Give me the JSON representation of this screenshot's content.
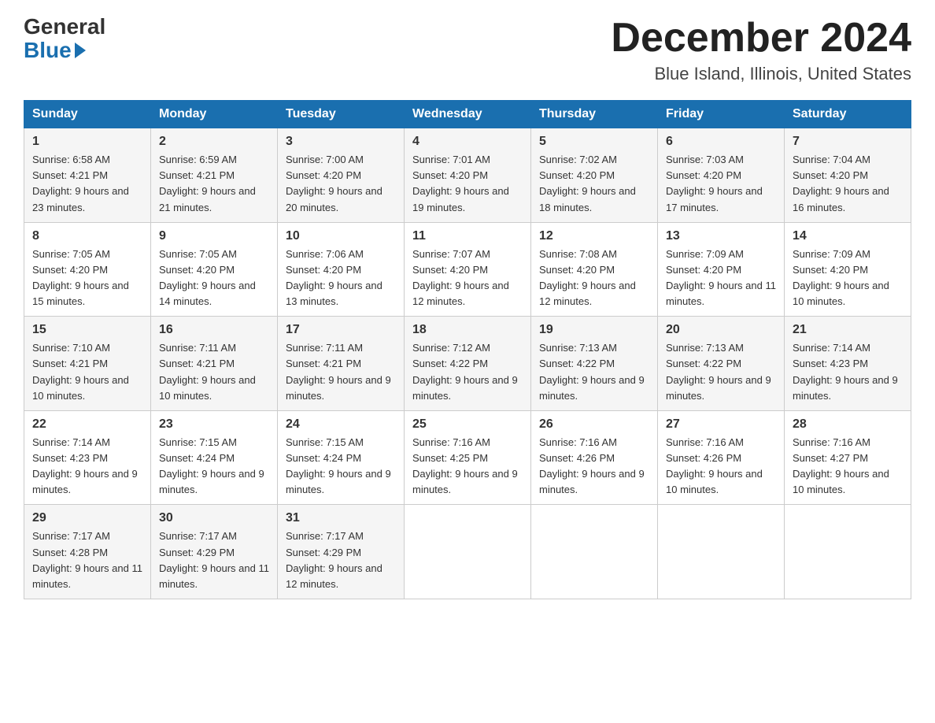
{
  "logo": {
    "general": "General",
    "blue": "Blue"
  },
  "header": {
    "month": "December 2024",
    "location": "Blue Island, Illinois, United States"
  },
  "days_of_week": [
    "Sunday",
    "Monday",
    "Tuesday",
    "Wednesday",
    "Thursday",
    "Friday",
    "Saturday"
  ],
  "weeks": [
    [
      {
        "day": "1",
        "sunrise": "6:58 AM",
        "sunset": "4:21 PM",
        "daylight": "9 hours and 23 minutes."
      },
      {
        "day": "2",
        "sunrise": "6:59 AM",
        "sunset": "4:21 PM",
        "daylight": "9 hours and 21 minutes."
      },
      {
        "day": "3",
        "sunrise": "7:00 AM",
        "sunset": "4:20 PM",
        "daylight": "9 hours and 20 minutes."
      },
      {
        "day": "4",
        "sunrise": "7:01 AM",
        "sunset": "4:20 PM",
        "daylight": "9 hours and 19 minutes."
      },
      {
        "day": "5",
        "sunrise": "7:02 AM",
        "sunset": "4:20 PM",
        "daylight": "9 hours and 18 minutes."
      },
      {
        "day": "6",
        "sunrise": "7:03 AM",
        "sunset": "4:20 PM",
        "daylight": "9 hours and 17 minutes."
      },
      {
        "day": "7",
        "sunrise": "7:04 AM",
        "sunset": "4:20 PM",
        "daylight": "9 hours and 16 minutes."
      }
    ],
    [
      {
        "day": "8",
        "sunrise": "7:05 AM",
        "sunset": "4:20 PM",
        "daylight": "9 hours and 15 minutes."
      },
      {
        "day": "9",
        "sunrise": "7:05 AM",
        "sunset": "4:20 PM",
        "daylight": "9 hours and 14 minutes."
      },
      {
        "day": "10",
        "sunrise": "7:06 AM",
        "sunset": "4:20 PM",
        "daylight": "9 hours and 13 minutes."
      },
      {
        "day": "11",
        "sunrise": "7:07 AM",
        "sunset": "4:20 PM",
        "daylight": "9 hours and 12 minutes."
      },
      {
        "day": "12",
        "sunrise": "7:08 AM",
        "sunset": "4:20 PM",
        "daylight": "9 hours and 12 minutes."
      },
      {
        "day": "13",
        "sunrise": "7:09 AM",
        "sunset": "4:20 PM",
        "daylight": "9 hours and 11 minutes."
      },
      {
        "day": "14",
        "sunrise": "7:09 AM",
        "sunset": "4:20 PM",
        "daylight": "9 hours and 10 minutes."
      }
    ],
    [
      {
        "day": "15",
        "sunrise": "7:10 AM",
        "sunset": "4:21 PM",
        "daylight": "9 hours and 10 minutes."
      },
      {
        "day": "16",
        "sunrise": "7:11 AM",
        "sunset": "4:21 PM",
        "daylight": "9 hours and 10 minutes."
      },
      {
        "day": "17",
        "sunrise": "7:11 AM",
        "sunset": "4:21 PM",
        "daylight": "9 hours and 9 minutes."
      },
      {
        "day": "18",
        "sunrise": "7:12 AM",
        "sunset": "4:22 PM",
        "daylight": "9 hours and 9 minutes."
      },
      {
        "day": "19",
        "sunrise": "7:13 AM",
        "sunset": "4:22 PM",
        "daylight": "9 hours and 9 minutes."
      },
      {
        "day": "20",
        "sunrise": "7:13 AM",
        "sunset": "4:22 PM",
        "daylight": "9 hours and 9 minutes."
      },
      {
        "day": "21",
        "sunrise": "7:14 AM",
        "sunset": "4:23 PM",
        "daylight": "9 hours and 9 minutes."
      }
    ],
    [
      {
        "day": "22",
        "sunrise": "7:14 AM",
        "sunset": "4:23 PM",
        "daylight": "9 hours and 9 minutes."
      },
      {
        "day": "23",
        "sunrise": "7:15 AM",
        "sunset": "4:24 PM",
        "daylight": "9 hours and 9 minutes."
      },
      {
        "day": "24",
        "sunrise": "7:15 AM",
        "sunset": "4:24 PM",
        "daylight": "9 hours and 9 minutes."
      },
      {
        "day": "25",
        "sunrise": "7:16 AM",
        "sunset": "4:25 PM",
        "daylight": "9 hours and 9 minutes."
      },
      {
        "day": "26",
        "sunrise": "7:16 AM",
        "sunset": "4:26 PM",
        "daylight": "9 hours and 9 minutes."
      },
      {
        "day": "27",
        "sunrise": "7:16 AM",
        "sunset": "4:26 PM",
        "daylight": "9 hours and 10 minutes."
      },
      {
        "day": "28",
        "sunrise": "7:16 AM",
        "sunset": "4:27 PM",
        "daylight": "9 hours and 10 minutes."
      }
    ],
    [
      {
        "day": "29",
        "sunrise": "7:17 AM",
        "sunset": "4:28 PM",
        "daylight": "9 hours and 11 minutes."
      },
      {
        "day": "30",
        "sunrise": "7:17 AM",
        "sunset": "4:29 PM",
        "daylight": "9 hours and 11 minutes."
      },
      {
        "day": "31",
        "sunrise": "7:17 AM",
        "sunset": "4:29 PM",
        "daylight": "9 hours and 12 minutes."
      },
      null,
      null,
      null,
      null
    ]
  ],
  "labels": {
    "sunrise": "Sunrise:",
    "sunset": "Sunset:",
    "daylight": "Daylight:"
  }
}
